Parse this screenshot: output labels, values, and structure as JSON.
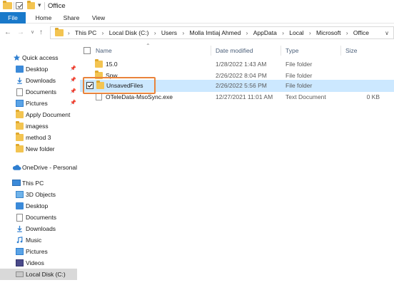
{
  "window": {
    "title": "Office"
  },
  "ribbon": {
    "tabs": [
      "File",
      "Home",
      "Share",
      "View"
    ]
  },
  "address": {
    "crumbs": [
      "This PC",
      "Local Disk (C:)",
      "Users",
      "Molla Imtiaj Ahmed",
      "AppData",
      "Local",
      "Microsoft",
      "Office"
    ]
  },
  "navpane": {
    "quick_access": "Quick access",
    "quick_items": [
      {
        "label": "Desktop",
        "icon": "desktop-icon",
        "pinned": true
      },
      {
        "label": "Downloads",
        "icon": "downloads-icon",
        "pinned": true
      },
      {
        "label": "Documents",
        "icon": "documents-icon",
        "pinned": true
      },
      {
        "label": "Pictures",
        "icon": "pictures-icon",
        "pinned": true
      },
      {
        "label": "Apply Document",
        "icon": "folder-icon",
        "pinned": false
      },
      {
        "label": "imagess",
        "icon": "folder-icon",
        "pinned": false
      },
      {
        "label": "method 3",
        "icon": "folder-icon",
        "pinned": false
      },
      {
        "label": "New folder",
        "icon": "folder-icon",
        "pinned": false
      }
    ],
    "onedrive": "OneDrive - Personal",
    "this_pc": "This PC",
    "pc_items": [
      {
        "label": "3D Objects",
        "icon": "3d-objects-icon"
      },
      {
        "label": "Desktop",
        "icon": "desktop-icon"
      },
      {
        "label": "Documents",
        "icon": "documents-icon"
      },
      {
        "label": "Downloads",
        "icon": "downloads-icon"
      },
      {
        "label": "Music",
        "icon": "music-icon"
      },
      {
        "label": "Pictures",
        "icon": "pictures-icon"
      },
      {
        "label": "Videos",
        "icon": "videos-icon"
      },
      {
        "label": "Local Disk (C:)",
        "icon": "drive-icon"
      }
    ]
  },
  "files": {
    "columns": {
      "name": "Name",
      "date": "Date modified",
      "type": "Type",
      "size": "Size"
    },
    "rows": [
      {
        "name": "15.0",
        "date": "1/28/2022 1:43 AM",
        "type": "File folder",
        "size": "",
        "kind": "folder"
      },
      {
        "name": "Spw",
        "date": "2/26/2022 8:04 PM",
        "type": "File folder",
        "size": "",
        "kind": "folder"
      },
      {
        "name": "UnsavedFiles",
        "date": "2/26/2022 5:56 PM",
        "type": "File folder",
        "size": "",
        "kind": "folder"
      },
      {
        "name": "OTeleData-MsoSync.exe",
        "date": "12/27/2021 11:01 AM",
        "type": "Text Document",
        "size": "0 KB",
        "kind": "document"
      }
    ]
  },
  "colors": {
    "accent": "#1979ca",
    "selection": "#cce8ff",
    "highlight": "#e9833b",
    "folder": "#f3c451"
  }
}
